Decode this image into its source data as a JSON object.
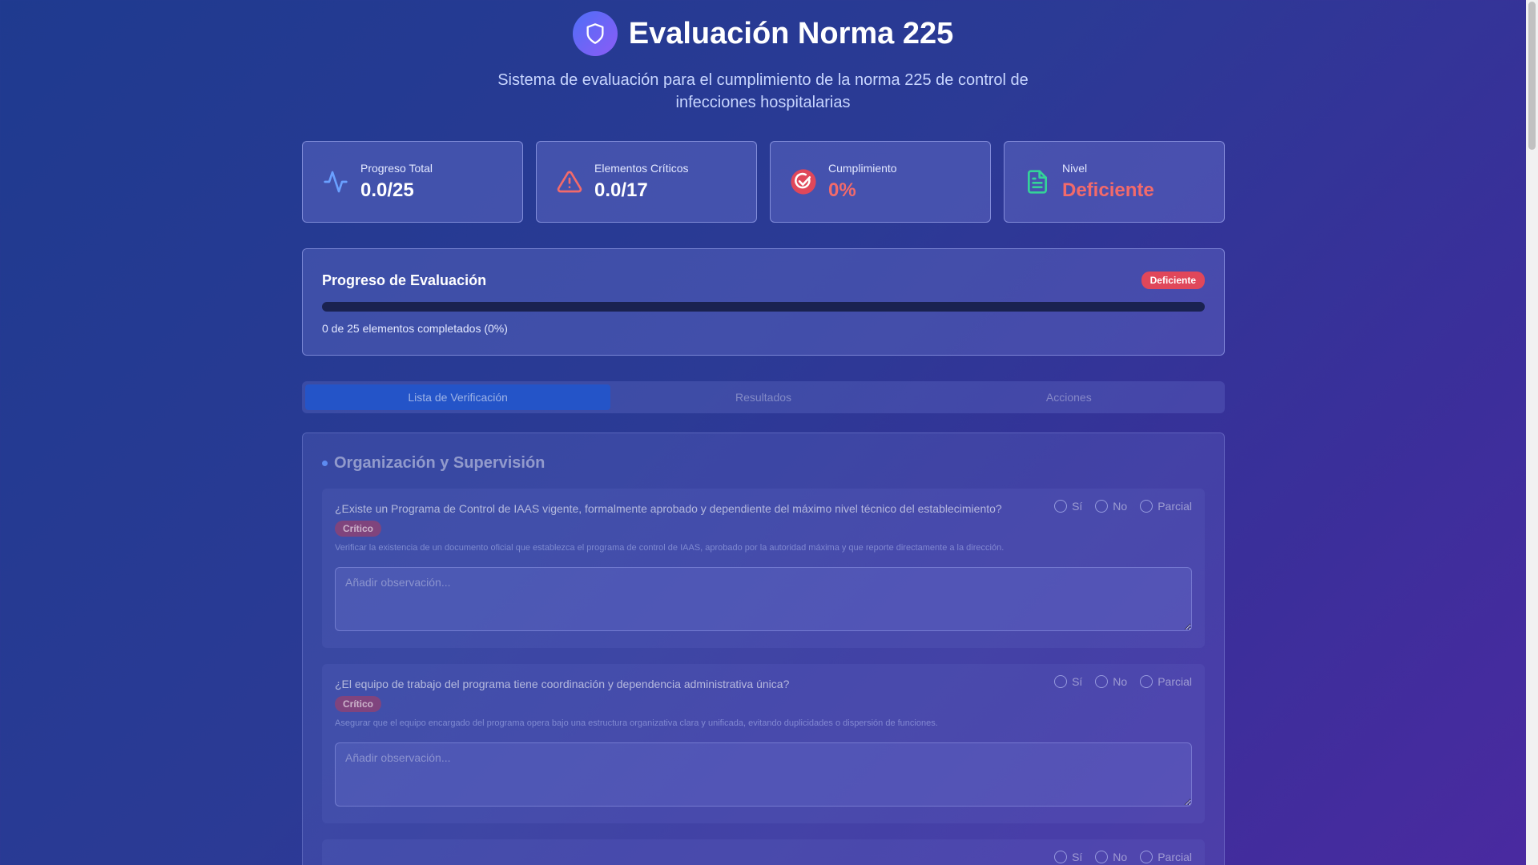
{
  "header": {
    "title": "Evaluación Norma 225",
    "subtitle": "Sistema de evaluación para el cumplimiento de la norma 225 de control de infecciones hospitalarias",
    "logo_icon": "shield-icon"
  },
  "stats": [
    {
      "label": "Progreso Total",
      "value": "0.0/25",
      "icon": "activity-icon",
      "color": "#6aa0ff"
    },
    {
      "label": "Elementos Críticos",
      "value": "0.0/17",
      "icon": "alert-triangle-icon",
      "color": "#f36a6a"
    },
    {
      "label": "Cumplimiento",
      "value": "0%",
      "icon": "check-circle-icon",
      "color": "#f36a6a"
    },
    {
      "label": "Nivel",
      "value": "Deficiente",
      "icon": "document-icon",
      "color": "#34d399"
    }
  ],
  "progress": {
    "title": "Progreso de Evaluación",
    "badge": "Deficiente",
    "percent": 0,
    "text": "0 de 25 elementos completados (0%)"
  },
  "tabs": [
    {
      "label": "Lista de Verificación",
      "active": true
    },
    {
      "label": "Resultados",
      "active": false
    },
    {
      "label": "Acciones",
      "active": false
    }
  ],
  "section": {
    "title": "Organización y Supervisión",
    "items": [
      {
        "question": "¿Existe un Programa de Control de IAAS vigente, formalmente aprobado y dependiente del máximo nivel técnico del establecimiento?",
        "tag": "Crítico",
        "description": "Verificar la existencia de un documento oficial que establezca el programa de control de IAAS, aprobado por la autoridad máxima y que reporte directamente a la dirección.",
        "placeholder": "Añadir observación..."
      },
      {
        "question": "¿El equipo de trabajo del programa tiene coordinación y dependencia administrativa única?",
        "tag": "Crítico",
        "description": "Asegurar que el equipo encargado del programa opera bajo una estructura organizativa clara y unificada, evitando duplicidades o dispersión de funciones.",
        "placeholder": "Añadir observación..."
      }
    ],
    "options": [
      "Sí",
      "No",
      "Parcial"
    ]
  }
}
